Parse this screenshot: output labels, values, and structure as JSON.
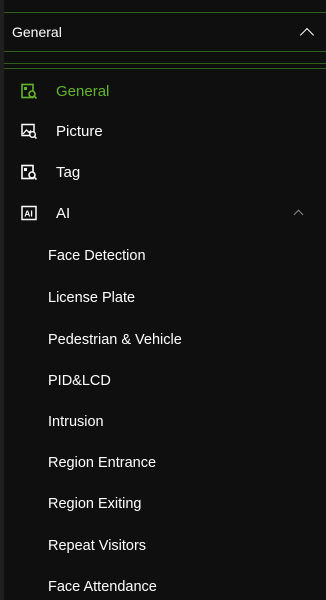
{
  "header": {
    "title": "General"
  },
  "nav": {
    "items": [
      {
        "label": "General",
        "icon": "video-search-icon",
        "active": true
      },
      {
        "label": "Picture",
        "icon": "image-search-icon",
        "active": false
      },
      {
        "label": "Tag",
        "icon": "tag-search-icon",
        "active": false
      },
      {
        "label": "AI",
        "icon": "ai-icon",
        "active": false,
        "expanded": true
      }
    ],
    "ai_subitems": [
      "Face Detection",
      "License Plate",
      "Pedestrian & Vehicle",
      "PID&LCD",
      "Intrusion",
      "Region Entrance",
      "Region Exiting",
      "Repeat Visitors",
      "Face Attendance"
    ]
  },
  "colors": {
    "accent": "#62b62a",
    "background": "#0f0f0f",
    "divider": "#2f5f1a",
    "text": "#ffffff"
  }
}
